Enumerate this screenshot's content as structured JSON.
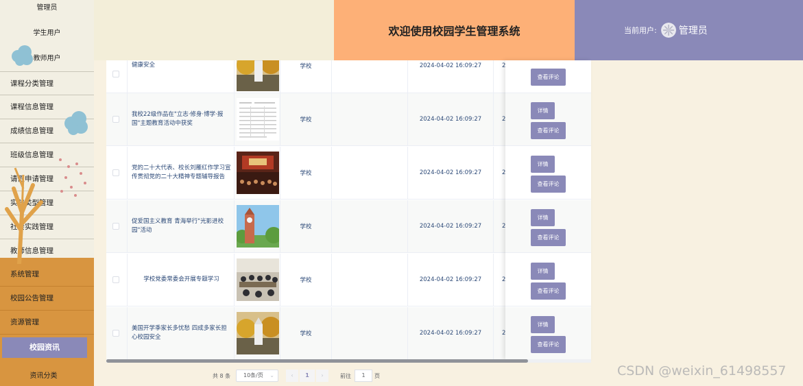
{
  "sidebar": {
    "sub_top": [
      "管理员",
      "学生用户",
      "教师用户"
    ],
    "menus": [
      "课程分类管理",
      "课程信息管理",
      "成绩信息管理",
      "班级信息管理",
      "请假申请管理",
      "实践类型管理",
      "社会实践管理",
      "教师信息管理"
    ],
    "orange_menus": [
      "系统管理",
      "校园公告管理",
      "资源管理"
    ],
    "active_sub": "校园资讯",
    "bottom_sub": "资讯分类"
  },
  "header": {
    "title": "欢迎使用校园学生管理系统",
    "user_label": "当前用户:",
    "user_name": "管理员"
  },
  "table": {
    "rows": [
      {
        "title": "北京北华校园疫情防控 全力守护师生健康安全",
        "image": "campus-autumn-photo",
        "category": "学校",
        "time": "2024-04-02 16:09:27",
        "more": "2"
      },
      {
        "title": "我校22级作品在\"立志·修身·博学·报国\"主题教育活动中获奖",
        "image": "certificate-document-photo",
        "category": "学校",
        "time": "2024-04-02 16:09:27",
        "more": "2"
      },
      {
        "title": "党的二十大代表、校长刘雁红作学习宣传贯彻党的二十大精神专题辅导报告",
        "image": "auditorium-lecture-photo",
        "category": "学校",
        "time": "2024-04-02 16:09:27",
        "more": "2"
      },
      {
        "title": "促爱国主义教育 青海举行\"光影进校园\"活动",
        "image": "clock-tower-photo",
        "category": "学校",
        "time": "2024-04-02 16:09:27",
        "more": "2"
      },
      {
        "title": "学校党委常委会开展专题学习",
        "image": "meeting-room-photo",
        "category": "学校",
        "time": "2024-04-02 16:09:27",
        "more": "2"
      },
      {
        "title": "美国开学季家长多忧愁 四成多家长担心校园安全",
        "image": "campus-autumn-photo",
        "category": "学校",
        "time": "2024-04-02 16:09:27",
        "more": "2"
      }
    ],
    "detail_label": "详情",
    "review_label": "查看评论"
  },
  "pagination": {
    "total": "共 8 条",
    "page_size": "10条/页",
    "prev": "‹",
    "current_page": "1",
    "next": "›",
    "goto_label": "前往",
    "goto_value": "1",
    "page_suffix": "页"
  },
  "watermark": "CSDN @weixin_61498557",
  "colors": {
    "accent": "#8a89b8",
    "header_title_bg": "#fdb077",
    "sidebar_orange": "#d89540",
    "page_bg": "#f8f1e1"
  }
}
